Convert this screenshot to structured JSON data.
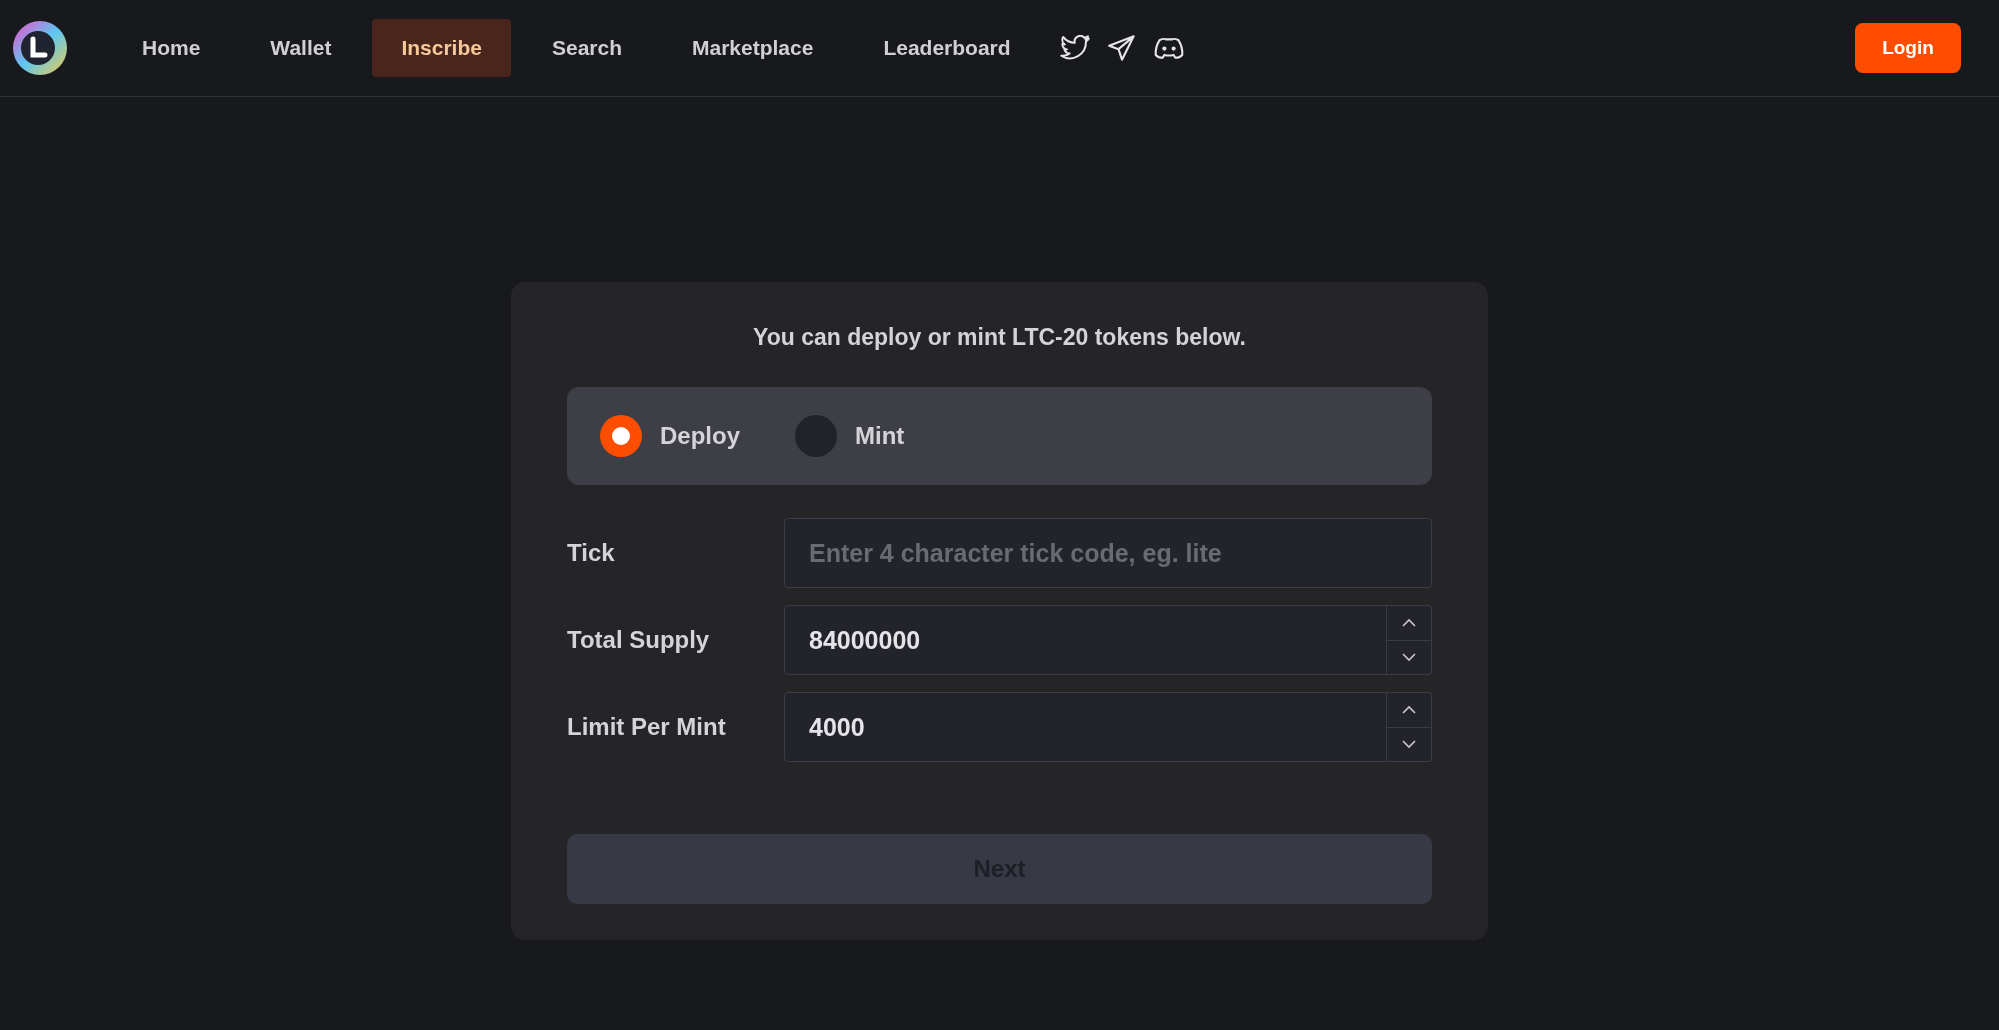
{
  "nav": {
    "items": [
      {
        "label": "Home",
        "selected": false
      },
      {
        "label": "Wallet",
        "selected": false
      },
      {
        "label": "Inscribe",
        "selected": true
      },
      {
        "label": "Search",
        "selected": false
      },
      {
        "label": "Marketplace",
        "selected": false
      },
      {
        "label": "Leaderboard",
        "selected": false
      }
    ],
    "login": "Login"
  },
  "form": {
    "title": "You can deploy or mint LTC-20 tokens below.",
    "modes": [
      {
        "label": "Deploy",
        "selected": true
      },
      {
        "label": "Mint",
        "selected": false
      }
    ],
    "fields": [
      {
        "label": "Tick",
        "kind": "text",
        "placeholder": "Enter 4 character tick code, eg. lite"
      },
      {
        "label": "Total Supply",
        "kind": "number",
        "value": "84000000"
      },
      {
        "label": "Limit Per Mint",
        "kind": "number",
        "value": "4000"
      }
    ],
    "next": {
      "label": "Next",
      "disabled": true
    }
  }
}
